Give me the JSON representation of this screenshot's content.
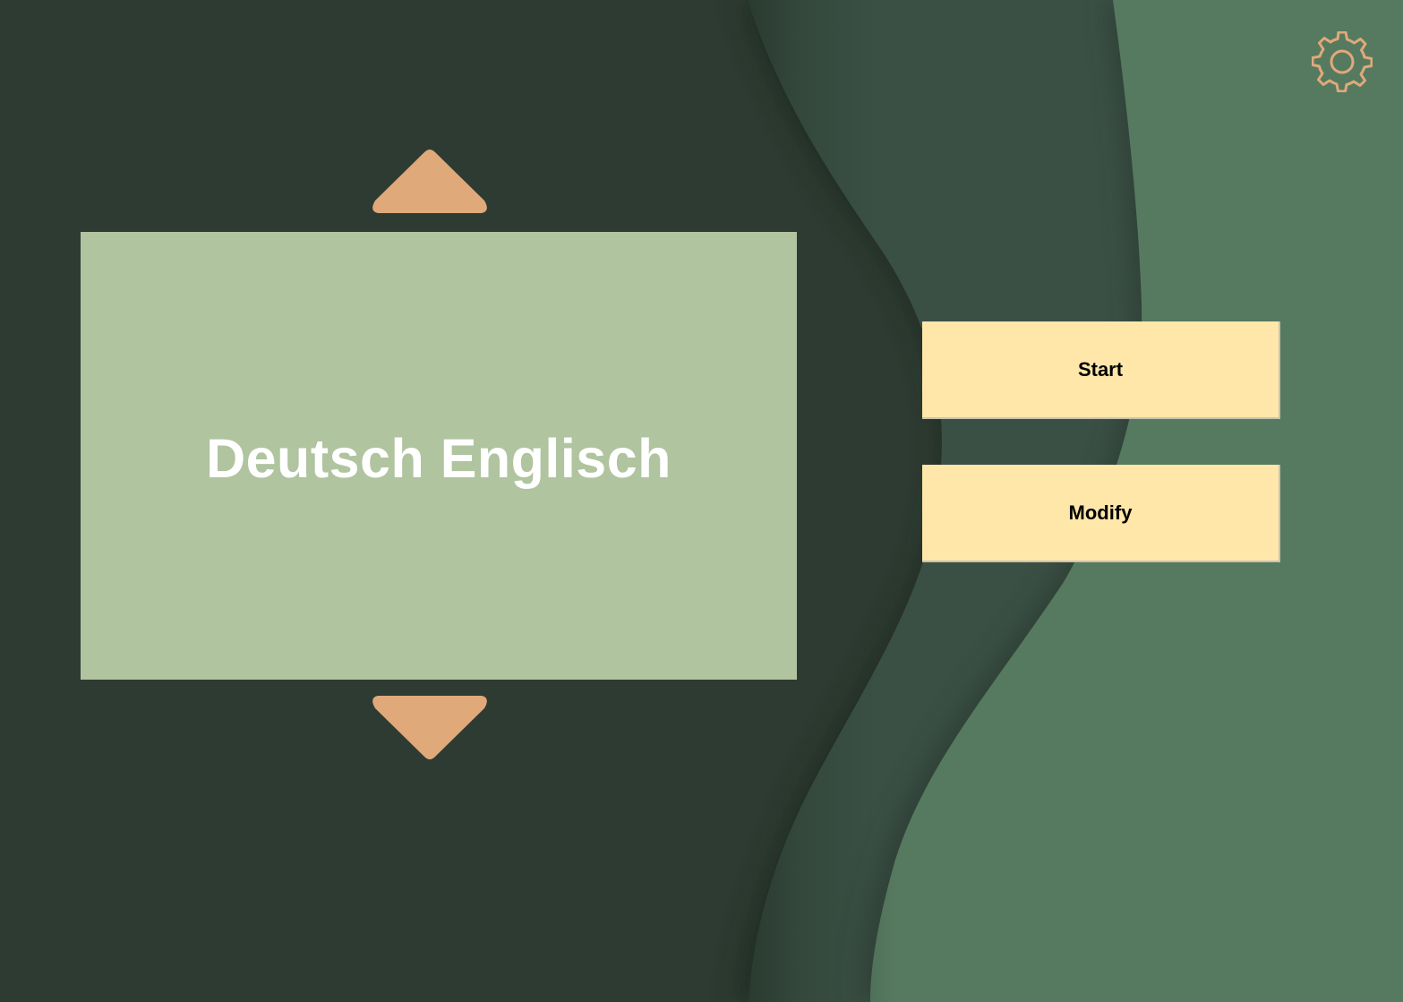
{
  "deck": {
    "title": "Deutsch Englisch"
  },
  "actions": {
    "start_label": "Start",
    "modify_label": "Modify"
  },
  "icons": {
    "previous": "arrow-up-icon",
    "next": "arrow-down-icon",
    "settings": "gear-icon"
  },
  "colors": {
    "background_dark": "#2e3b32",
    "background_mid": "#3a4f43",
    "background_light": "#567a5e",
    "card": "#b0c49f",
    "button": "#ffe7a9",
    "accent": "#e0a97a",
    "title_text": "#ffffff"
  }
}
